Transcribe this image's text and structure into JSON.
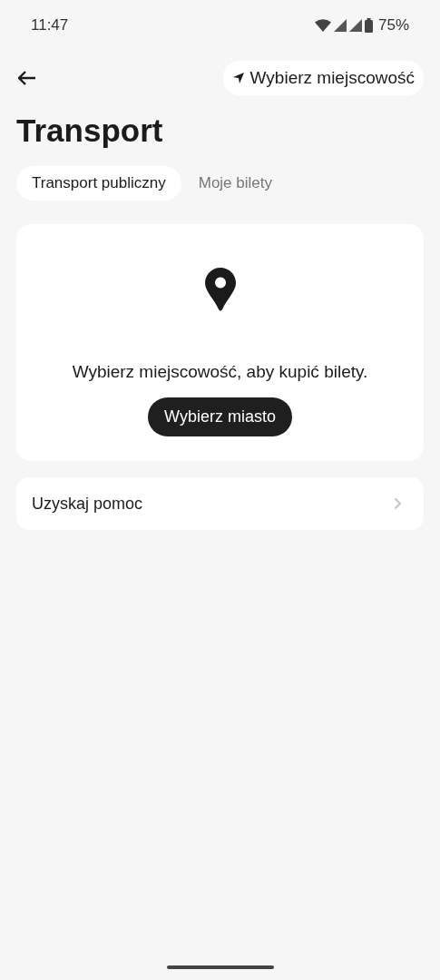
{
  "status_bar": {
    "time": "11:47",
    "battery": "75%"
  },
  "toolbar": {
    "location_button": "Wybierz miejscowość"
  },
  "title": "Transport",
  "tabs": [
    {
      "label": "Transport publiczny",
      "selected": true
    },
    {
      "label": "Moje bilety",
      "selected": false
    }
  ],
  "empty_card": {
    "message": "Wybierz miejscowość, aby kupić bilety.",
    "button": "Wybierz miasto"
  },
  "help_row": {
    "label": "Uzyskaj pomoc"
  }
}
